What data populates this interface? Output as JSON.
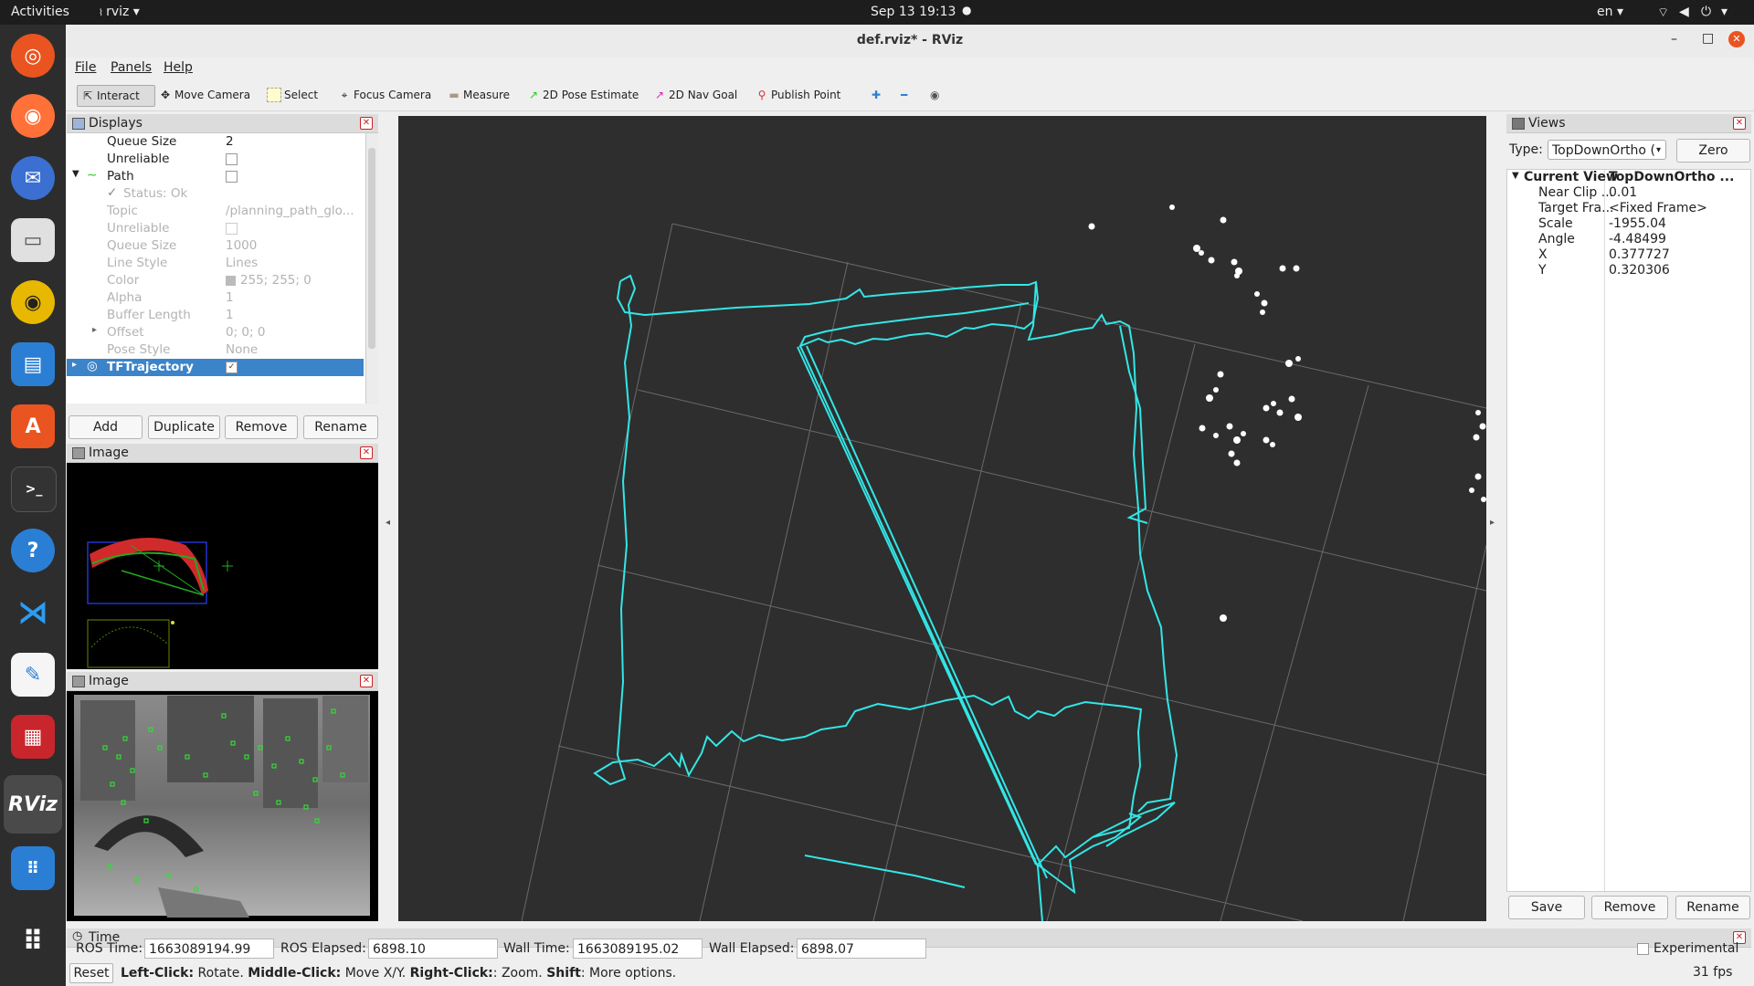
{
  "topbar": {
    "activities": "Activities",
    "app_name": "rviz",
    "app_menu_arrow": "▾",
    "datetime": "Sep 13  19:13",
    "lang": "en",
    "lang_arrow": "▾",
    "system_icons": [
      "network-icon",
      "volume-icon",
      "power-icon"
    ]
  },
  "dock": {
    "apps": [
      "ubuntu-logo",
      "firefox",
      "thunderbird",
      "files",
      "rhythmbox",
      "writer",
      "app-center",
      "terminal",
      "help",
      "vscode",
      "text-editor",
      "presentation",
      "rviz",
      "show-apps"
    ]
  },
  "window": {
    "title": "def.rviz* - RViz",
    "controls": [
      "–",
      "□",
      "✕"
    ]
  },
  "menu": {
    "file": "File",
    "panels": "Panels",
    "help": "Help"
  },
  "toolbar": {
    "interact": "Interact",
    "move_camera": "Move Camera",
    "select": "Select",
    "focus_camera": "Focus Camera",
    "measure": "Measure",
    "pose_estimate": "2D Pose Estimate",
    "nav_goal": "2D Nav Goal",
    "publish_point": "Publish Point",
    "icon_plus": "✚",
    "icon_minus": "━",
    "icon_eye": "◉"
  },
  "displays": {
    "title": "Displays",
    "rows": [
      {
        "key": "Queue Size",
        "value": "2"
      },
      {
        "key": "Unreliable",
        "value": ""
      },
      {
        "key": "Path",
        "value": ""
      },
      {
        "key": "Status: Ok",
        "value": ""
      },
      {
        "key": "Topic",
        "value": "/planning_path_glo..."
      },
      {
        "key": "Unreliable",
        "value": ""
      },
      {
        "key": "Queue Size",
        "value": "1000"
      },
      {
        "key": "Line Style",
        "value": "Lines"
      },
      {
        "key": "Color",
        "value": "255; 255; 0"
      },
      {
        "key": "Alpha",
        "value": "1"
      },
      {
        "key": "Buffer Length",
        "value": "1"
      },
      {
        "key": "Offset",
        "value": "0; 0; 0"
      },
      {
        "key": "Pose Style",
        "value": "None"
      },
      {
        "key": "TFTrajectory",
        "value": ""
      }
    ],
    "buttons": {
      "add": "Add",
      "duplicate": "Duplicate",
      "remove": "Remove",
      "rename": "Rename"
    }
  },
  "image1": {
    "title": "Image"
  },
  "image2": {
    "title": "Image"
  },
  "views": {
    "title": "Views",
    "type_label": "Type:",
    "type_value": "TopDownOrtho (",
    "zero": "Zero",
    "current_view": "Current View",
    "current_view_value": "TopDownOrtho ...",
    "props": [
      {
        "key": "Near Clip ...",
        "value": "0.01"
      },
      {
        "key": "Target Fra...",
        "value": "<Fixed Frame>"
      },
      {
        "key": "Scale",
        "value": "-1955.04"
      },
      {
        "key": "Angle",
        "value": "-4.48499"
      },
      {
        "key": "X",
        "value": "0.377727"
      },
      {
        "key": "Y",
        "value": "0.320306"
      }
    ],
    "buttons": {
      "save": "Save",
      "remove": "Remove",
      "rename": "Rename"
    }
  },
  "time": {
    "title": "Time",
    "ros_time_label": "ROS Time:",
    "ros_time": "1663089194.99",
    "ros_elapsed_label": "ROS Elapsed:",
    "ros_elapsed": "6898.10",
    "wall_time_label": "Wall Time:",
    "wall_time": "1663089195.02",
    "wall_elapsed_label": "Wall Elapsed:",
    "wall_elapsed": "6898.07",
    "experimental": "Experimental"
  },
  "status": {
    "reset": "Reset",
    "left_click": "Left-Click:",
    "left_click_desc": " Rotate. ",
    "middle_click": "Middle-Click:",
    "middle_click_desc": " Move X/Y. ",
    "right_click": "Right-Click:",
    "right_click_desc": ": Zoom. ",
    "shift": "Shift",
    "shift_desc": ": More options.",
    "fps": "31 fps"
  },
  "colors": {
    "trajectory": "#33e6e6",
    "selection": "#3b84c9",
    "grid": "#6a6a6a",
    "features": "#33dd33"
  }
}
